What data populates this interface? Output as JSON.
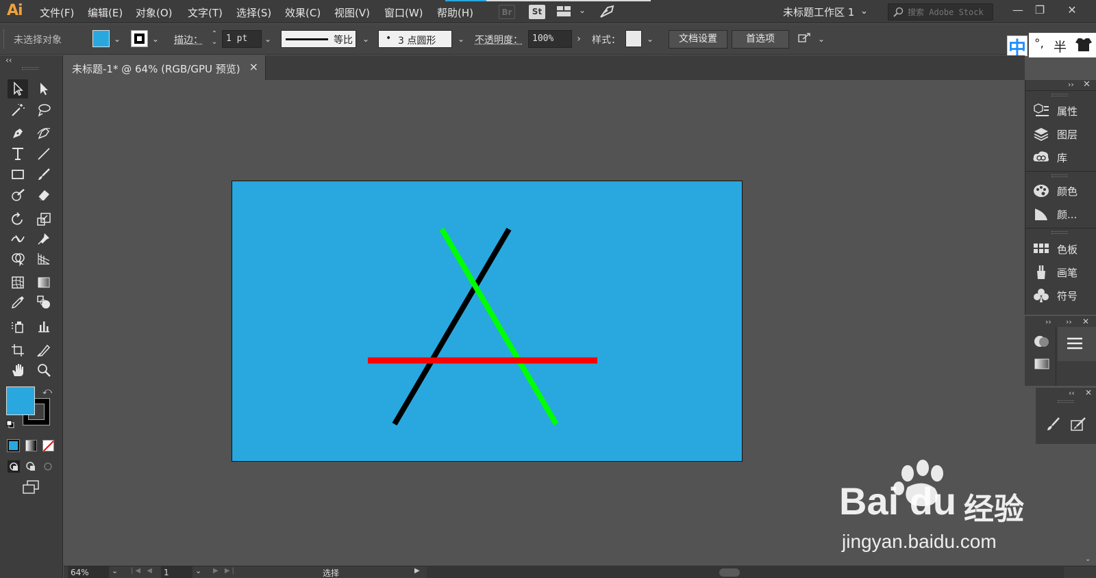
{
  "app": {
    "logo": "Ai"
  },
  "menu": [
    "文件(F)",
    "编辑(E)",
    "对象(O)",
    "文字(T)",
    "选择(S)",
    "效果(C)",
    "视图(V)",
    "窗口(W)",
    "帮助(H)"
  ],
  "menu_chips": {
    "bridge": "Br",
    "stock": "St"
  },
  "workspace": {
    "label": "未标题工作区 1"
  },
  "search": {
    "placeholder": "搜索 Adobe Stock"
  },
  "window_controls": {
    "minimize": "—",
    "restore": "❐",
    "close": "✕"
  },
  "control_bar": {
    "selection_status": "未选择对象",
    "fill_color": "#29a8e0",
    "stroke_label": "描边：",
    "stroke_weight": "1 pt",
    "stroke_profile": "等比",
    "brush": "3 点圆形",
    "opacity_label": "不透明度：",
    "opacity_value": "100%",
    "style_label": "样式：",
    "document_setup_button": "文档设置",
    "preferences_button": "首选项"
  },
  "ime": {
    "mode": "中",
    "punct": "°,",
    "width": "半"
  },
  "document_tab": {
    "title": "未标题-1* @ 64% (RGB/GPU 预览)",
    "close": "×"
  },
  "artboard": {
    "background": "#29a8e0",
    "lines": [
      {
        "name": "black-line",
        "color": "#000000"
      },
      {
        "name": "green-line",
        "color": "#00ff00"
      },
      {
        "name": "red-line",
        "color": "#ff0000"
      }
    ]
  },
  "right_panel": {
    "items": [
      {
        "label": "属性",
        "icon": "properties-icon"
      },
      {
        "label": "图层",
        "icon": "layers-icon"
      },
      {
        "label": "库",
        "icon": "libraries-icon"
      },
      {
        "label": "颜色",
        "icon": "color-icon"
      },
      {
        "label": "颜...",
        "icon": "color-guide-icon"
      },
      {
        "label": "色板",
        "icon": "swatches-icon"
      },
      {
        "label": "画笔",
        "icon": "brushes-icon"
      },
      {
        "label": "符号",
        "icon": "symbols-icon"
      }
    ],
    "collapse": "››",
    "close": "✕"
  },
  "status_bar": {
    "zoom": "64%",
    "page": "1",
    "tool": "选择"
  },
  "watermark": {
    "brand": "Bai  du",
    "suffix": "经验",
    "url": "jingyan.baidu.com"
  }
}
